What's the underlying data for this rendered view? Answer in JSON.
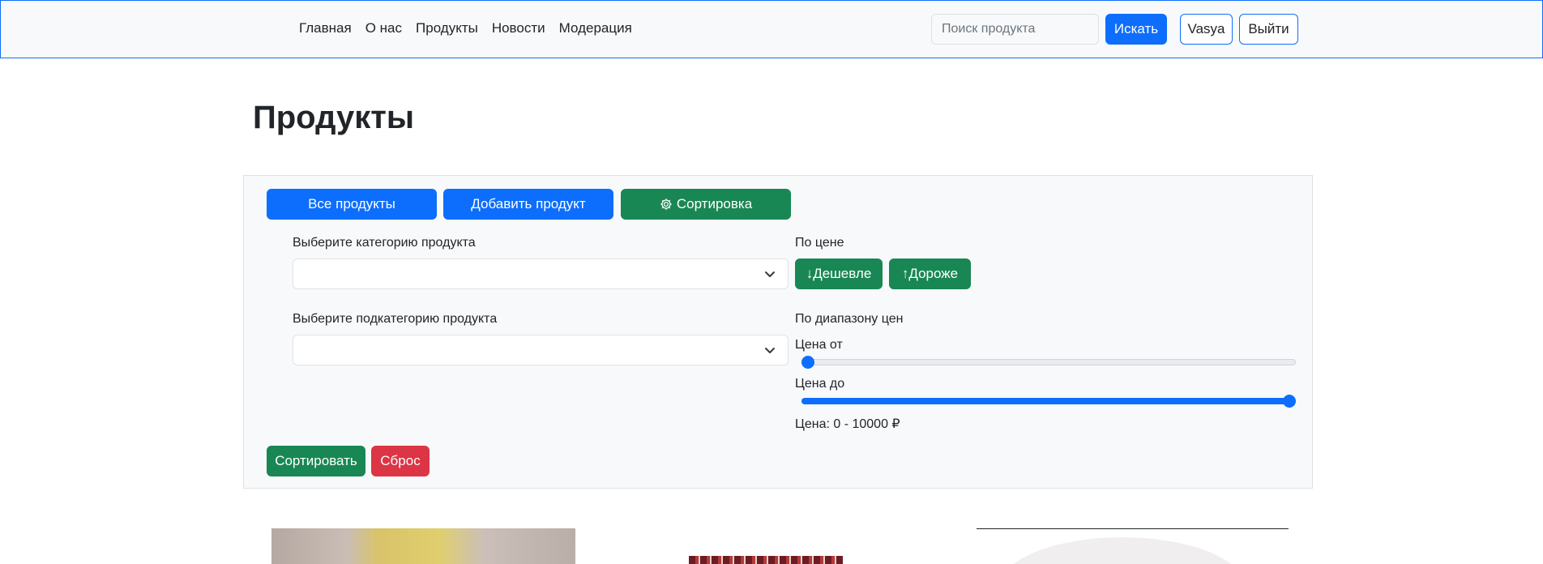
{
  "nav": {
    "links": [
      "Главная",
      "О нас",
      "Продукты",
      "Новости",
      "Модерация"
    ],
    "search_placeholder": "Поиск продукта",
    "search_label": "Искать",
    "user_label": "Vasya",
    "logout_label": "Выйти"
  },
  "page": {
    "title": "Продукты"
  },
  "filters": {
    "tabs": [
      "Все продукты",
      "Добавить продукт",
      "Сортировка"
    ],
    "category_label": "Выберите категорию продукта",
    "category_value": "",
    "subcategory_label": "Выберите подкатегорию продукта",
    "subcategory_value": "",
    "by_price_label": "По цене",
    "cheaper_label": "Дешевле",
    "pricier_label": "Дороже",
    "by_range_label": "По диапазону цен",
    "price_from_label": "Цена от",
    "price_to_label": "Цена до",
    "price_from_value": 0,
    "price_to_value": 10000,
    "price_max": 10000,
    "price_summary": "Цена: 0 - 10000 ₽",
    "sort_label": "Сортировать",
    "reset_label": "Сброс"
  },
  "colors": {
    "primary": "#0d6efd",
    "success": "#198754",
    "danger": "#dc3545"
  }
}
